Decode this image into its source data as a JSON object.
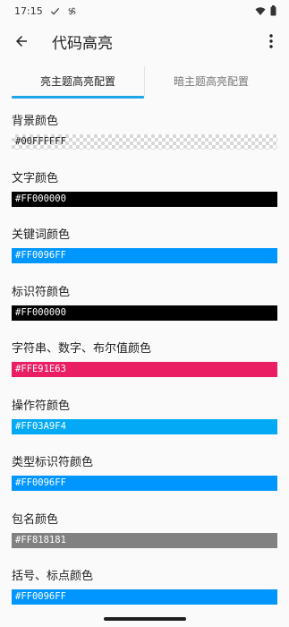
{
  "status_bar": {
    "time": "17:15",
    "icons": [
      "check-icon",
      "pinwheel-icon",
      "wifi-icon",
      "battery-icon"
    ]
  },
  "app_bar": {
    "back_icon": "arrow-left-icon",
    "title": "代码高亮",
    "menu_icon": "more-vert-icon"
  },
  "tabs": [
    {
      "label": "亮主题高亮配置",
      "active": true
    },
    {
      "label": "暗主题高亮配置",
      "active": false
    }
  ],
  "colors": [
    {
      "label": "背景颜色",
      "value": "#00FFFFFF",
      "swatch": "transparent"
    },
    {
      "label": "文字颜色",
      "value": "#FF000000",
      "swatch": "#000000"
    },
    {
      "label": "关键词颜色",
      "value": "#FF0096FF",
      "swatch": "#0096FF"
    },
    {
      "label": "标识符颜色",
      "value": "#FF000000",
      "swatch": "#000000"
    },
    {
      "label": "字符串、数字、布尔值颜色",
      "value": "#FFE91E63",
      "swatch": "#E91E63"
    },
    {
      "label": "操作符颜色",
      "value": "#FF03A9F4",
      "swatch": "#03A9F4"
    },
    {
      "label": "类型标识符颜色",
      "value": "#FF0096FF",
      "swatch": "#0096FF"
    },
    {
      "label": "包名颜色",
      "value": "#FF818181",
      "swatch": "#818181"
    },
    {
      "label": "括号、标点颜色",
      "value": "#FF0096FF",
      "swatch": "#0096FF"
    }
  ],
  "theme": {
    "accent": "#1FA6E8",
    "background": "#FAFAFA"
  }
}
